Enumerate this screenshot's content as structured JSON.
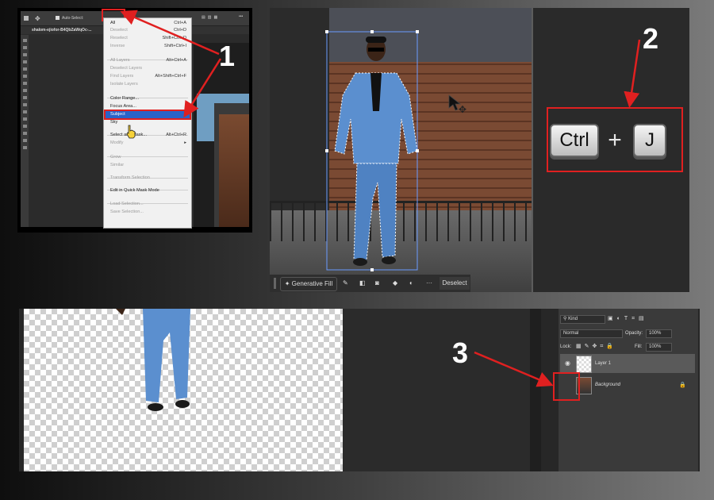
{
  "steps": {
    "one": "1",
    "two": "2",
    "three": "3"
  },
  "photoshop_menu": {
    "tab_title": "shalom-ejiofor-B4QbZaWqOc-...",
    "options_auto_select": "Auto-Select:",
    "items": [
      {
        "label": "All",
        "shortcut": "Ctrl+A",
        "disabled": false
      },
      {
        "label": "Deselect",
        "shortcut": "Ctrl+D",
        "disabled": true
      },
      {
        "label": "Reselect",
        "shortcut": "Shift+Ctrl+D",
        "disabled": true
      },
      {
        "label": "Inverse",
        "shortcut": "Shift+Ctrl+I",
        "disabled": true
      },
      {
        "label": "All Layers",
        "shortcut": "Alt+Ctrl+A",
        "disabled": true
      },
      {
        "label": "Deselect Layers",
        "shortcut": "",
        "disabled": true
      },
      {
        "label": "Find Layers",
        "shortcut": "Alt+Shift+Ctrl+F",
        "disabled": true
      },
      {
        "label": "Isolate Layers",
        "shortcut": "",
        "disabled": true
      },
      {
        "label": "Color Range...",
        "shortcut": "",
        "disabled": false
      },
      {
        "label": "Focus Area...",
        "shortcut": "",
        "disabled": false
      },
      {
        "label": "Subject",
        "shortcut": "",
        "disabled": false,
        "highlighted": true
      },
      {
        "label": "Sky",
        "shortcut": "",
        "disabled": false
      },
      {
        "label": "Select and Mask...",
        "shortcut": "Alt+Ctrl+R",
        "disabled": false
      },
      {
        "label": "Modify",
        "shortcut": "▸",
        "disabled": true
      },
      {
        "label": "Grow",
        "shortcut": "",
        "disabled": true
      },
      {
        "label": "Similar",
        "shortcut": "",
        "disabled": true
      },
      {
        "label": "Transform Selection",
        "shortcut": "",
        "disabled": true
      },
      {
        "label": "Edit in Quick Mask Mode",
        "shortcut": "",
        "disabled": false
      },
      {
        "label": "Load Selection...",
        "shortcut": "",
        "disabled": true
      },
      {
        "label": "Save Selection...",
        "shortcut": "",
        "disabled": true
      }
    ]
  },
  "canvas_toolbar": {
    "generative_fill": "Generative Fill",
    "deselect": "Deselect",
    "more": "···"
  },
  "shortcut": {
    "key1": "Ctrl",
    "plus": "+",
    "key2": "J"
  },
  "layers_panel": {
    "filter_kind": "Kind",
    "blend_mode": "Normal",
    "opacity_label": "Opacity:",
    "opacity_value": "100%",
    "lock_label": "Lock:",
    "fill_label": "Fill:",
    "fill_value": "100%",
    "layers": [
      {
        "name": "Layer 1",
        "visible": true,
        "selected": true
      },
      {
        "name": "Background",
        "visible": false,
        "locked": true
      }
    ]
  },
  "colors": {
    "accent_red": "#e02020",
    "menu_highlight": "#2a63c8",
    "suit_blue": "#5b8fcf"
  }
}
